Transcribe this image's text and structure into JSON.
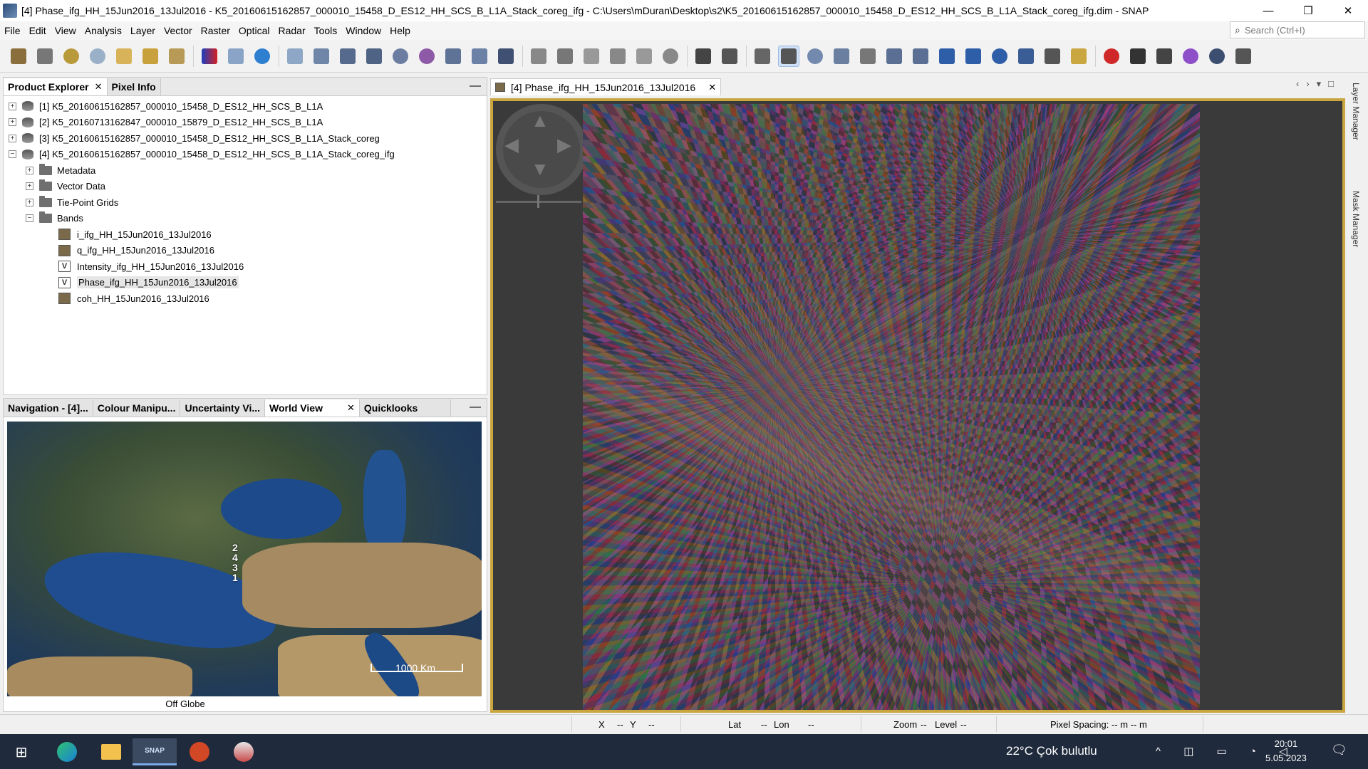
{
  "window": {
    "title": "[4] Phase_ifg_HH_15Jun2016_13Jul2016 - K5_20160615162857_000010_15458_D_ES12_HH_SCS_B_L1A_Stack_coreg_ifg - C:\\Users\\mDuran\\Desktop\\s2\\K5_20160615162857_000010_15458_D_ES12_HH_SCS_B_L1A_Stack_coreg_ifg.dim - SNAP",
    "minimize": "—",
    "restore": "❐",
    "close": "✕"
  },
  "menu": [
    "File",
    "Edit",
    "View",
    "Analysis",
    "Layer",
    "Vector",
    "Raster",
    "Optical",
    "Radar",
    "Tools",
    "Window",
    "Help"
  ],
  "search": {
    "placeholder": "Search (Ctrl+I)"
  },
  "explorer": {
    "tabs": [
      "Product Explorer",
      "Pixel Info"
    ],
    "close_glyph": "✕",
    "minimize_glyph": "—",
    "products": [
      "[1] K5_20160615162857_000010_15458_D_ES12_HH_SCS_B_L1A",
      "[2] K5_20160713162847_000010_15879_D_ES12_HH_SCS_B_L1A",
      "[3] K5_20160615162857_000010_15458_D_ES12_HH_SCS_B_L1A_Stack_coreg",
      "[4] K5_20160615162857_000010_15458_D_ES12_HH_SCS_B_L1A_Stack_coreg_ifg"
    ],
    "folders": [
      "Metadata",
      "Vector Data",
      "Tie-Point Grids",
      "Bands"
    ],
    "bands": [
      "i_ifg_HH_15Jun2016_13Jul2016",
      "q_ifg_HH_15Jun2016_13Jul2016",
      "Intensity_ifg_HH_15Jun2016_13Jul2016",
      "Phase_ifg_HH_15Jun2016_13Jul2016",
      "coh_HH_15Jun2016_13Jul2016"
    ],
    "virtual_badge": "V",
    "expand_glyph": "+",
    "collapse_glyph": "−"
  },
  "bottom_panel": {
    "tabs": [
      "Navigation - [4]...",
      "Colour Manipu...",
      "Uncertainty Vi...",
      "World View",
      "Quicklooks"
    ],
    "close_glyph": "✕",
    "minimize_glyph": "—",
    "globe": {
      "markers": [
        "2",
        "4",
        "3",
        "1"
      ],
      "scale_label": "1000 Km",
      "caption": "Off Globe"
    }
  },
  "image_window": {
    "tab_label": "[4] Phase_ifg_HH_15Jun2016_13Jul2016",
    "close_glyph": "✕",
    "tab_controls": "‹›▾□"
  },
  "sidebar": {
    "labels": [
      "Layer Manager",
      "Mask Manager"
    ]
  },
  "statusbar": {
    "x": "X",
    "x_val": "--",
    "y": "Y",
    "y_val": "--",
    "lat": "Lat",
    "lat_val": "--",
    "lon": "Lon",
    "lon_val": "--",
    "zoom": "Zoom",
    "zoom_val": "--",
    "level": "Level",
    "level_val": "--",
    "pixel_spacing": "Pixel Spacing: -- m -- m"
  },
  "taskbar": {
    "weather": "22°C  Çok bulutlu",
    "tray": "^ ◫ ▭ ◔ ◁",
    "time": "20:01",
    "date": "5.05.2023",
    "snap_label": "SNAP"
  },
  "colors": {
    "accent_frame": "#c9a640",
    "taskbar": "#1f2a3c",
    "selected_tool": "#cfe0f7"
  }
}
